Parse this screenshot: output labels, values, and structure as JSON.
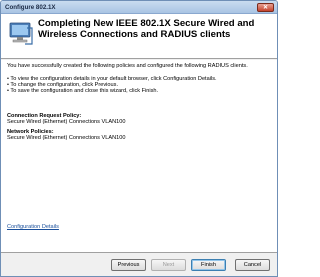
{
  "window": {
    "title": "Configure 802.1X",
    "close_glyph": "✕"
  },
  "header": {
    "title_line1": "Completing New IEEE 802.1X Secure Wired and",
    "title_line2": "Wireless Connections and RADIUS clients",
    "icon": "network-computer-icon"
  },
  "body": {
    "intro": "You have successfully created the following policies and configured the following RADIUS clients.",
    "bullets": [
      "• To view the configuration details in your default browser, click Configuration Details.",
      "• To change the configuration, click Previous.",
      "• To save the configuration and close this wizard, click Finish."
    ],
    "crp_label": "Connection Request Policy:",
    "crp_value": "Secure Wired (Ethernet) Connections VLAN100",
    "np_label": "Network Policies:",
    "np_value": "Secure Wired (Ethernet) Connections VLAN100",
    "details_link": "Configuration Details"
  },
  "buttons": {
    "previous": "Previous",
    "next": "Next",
    "finish": "Finish",
    "cancel": "Cancel"
  },
  "colors": {
    "link": "#1a4f9b",
    "titlebar": "#a9c4e3"
  }
}
